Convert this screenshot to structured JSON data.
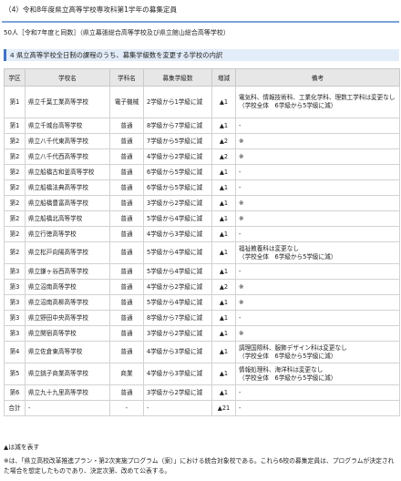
{
  "section_title": "（4）令和8年度県立高等学校専攻科第1学年の募集定員",
  "enrollment_line": "50人［令和7年度と同数］（県立幕張総合高等学校及び県立館山総合高等学校）",
  "table_heading": "4 県立高等学校全日制の課程のうち、募集学級数を変更する学校の内訳",
  "columns": [
    "学区",
    "学校名",
    "学科名",
    "募集学級数",
    "増減",
    "備考"
  ],
  "rows": [
    {
      "district": "第1",
      "school": "県立千葉工業高等学校",
      "dept": "電子機械",
      "classes": "2学級から1学級に減",
      "change": "▲1",
      "note": "電気科、情報技術科、工業化学科、理数工学科は変更なし\n（学校全体　6学級から5学級に減）"
    },
    {
      "district": "第1",
      "school": "県立千城台高等学校",
      "dept": "普通",
      "classes": "8学級から7学級に減",
      "change": "▲1",
      "note": "-"
    },
    {
      "district": "第2",
      "school": "県立八千代東高等学校",
      "dept": "普通",
      "classes": "7学級から5学級に減",
      "change": "▲2",
      "note": "※"
    },
    {
      "district": "第2",
      "school": "県立八千代西高等学校",
      "dept": "普通",
      "classes": "4学級から2学級に減",
      "change": "▲2",
      "note": "※"
    },
    {
      "district": "第2",
      "school": "県立船橋古和釜高等学校",
      "dept": "普通",
      "classes": "6学級から5学級に減",
      "change": "▲1",
      "note": "-"
    },
    {
      "district": "第2",
      "school": "県立船橋法典高等学校",
      "dept": "普通",
      "classes": "6学級から5学級に減",
      "change": "▲1",
      "note": "-"
    },
    {
      "district": "第2",
      "school": "県立船橋豊富高等学校",
      "dept": "普通",
      "classes": "3学級から2学級に減",
      "change": "▲1",
      "note": "※"
    },
    {
      "district": "第2",
      "school": "県立船橋北高等学校",
      "dept": "普通",
      "classes": "5学級から4学級に減",
      "change": "▲1",
      "note": "※"
    },
    {
      "district": "第2",
      "school": "県立行徳高等学校",
      "dept": "普通",
      "classes": "4学級から3学級に減",
      "change": "▲1",
      "note": "-"
    },
    {
      "district": "第2",
      "school": "県立松戸向陽高等学校",
      "dept": "普通",
      "classes": "5学級から4学級に減",
      "change": "▲1",
      "note": "福祉教養科は変更なし\n（学校全体　6学級から5学級に減）"
    },
    {
      "district": "第3",
      "school": "県立鎌ヶ谷西高等学校",
      "dept": "普通",
      "classes": "5学級から4学級に減",
      "change": "▲1",
      "note": "-"
    },
    {
      "district": "第3",
      "school": "県立沼南高等学校",
      "dept": "普通",
      "classes": "4学級から2学級に減",
      "change": "▲2",
      "note": "※"
    },
    {
      "district": "第3",
      "school": "県立沼南高柳高等学校",
      "dept": "普通",
      "classes": "5学級から4学級に減",
      "change": "▲1",
      "note": "※"
    },
    {
      "district": "第3",
      "school": "県立野田中央高等学校",
      "dept": "普通",
      "classes": "8学級から7学級に減",
      "change": "▲1",
      "note": "-"
    },
    {
      "district": "第3",
      "school": "県立関宿高等学校",
      "dept": "普通",
      "classes": "3学級から2学級に減",
      "change": "▲1",
      "note": "※"
    },
    {
      "district": "第4",
      "school": "県立佐倉東高等学校",
      "dept": "普通",
      "classes": "4学級から3学級に減",
      "change": "▲1",
      "note": "調理国際科、服飾デザイン科は変更なし\n（学校全体　6学級から5学級に減）"
    },
    {
      "district": "第5",
      "school": "県立銚子商業高等学校",
      "dept": "商業",
      "classes": "4学級から3学級に減",
      "change": "▲1",
      "note": "情報処理科、海洋科は変更なし\n（学校全体　6学級から5学級に減）"
    },
    {
      "district": "第6",
      "school": "県立九十九里高等学校",
      "dept": "普通",
      "classes": "3学級から2学級に減",
      "change": "▲1",
      "note": "-"
    },
    {
      "district": "合計",
      "school": "-",
      "dept": "-",
      "classes": "-",
      "change": "▲21",
      "note": "-"
    }
  ],
  "legend": "▲は減を表す",
  "footnote": "※は、「県立高校改革推進プラン・第2次実施プログラム（案）」における統合対象校である。これら6校の募集定員は、プログラムが決定された場合を想定したものであり、決定次第、改めて公表する。"
}
